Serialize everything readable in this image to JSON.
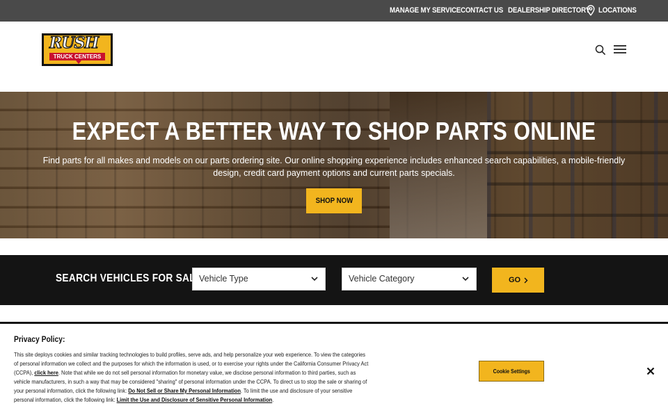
{
  "utility_nav": {
    "manage_service": "MANAGE MY SERVICE",
    "contact_us": "CONTACT US",
    "dealership_directory": "DEALERSHIP DIRECTORY",
    "locations": "LOCATIONS"
  },
  "header": {
    "logo_text": "RUSH",
    "logo_subtext": "TRUCK CENTERS",
    "search_icon": "search-icon",
    "menu_icon": "hamburger-menu-icon"
  },
  "hero": {
    "title": "EXPECT A BETTER WAY TO SHOP PARTS ONLINE",
    "description": "Find parts for all makes and models on our parts ordering site. Our online shopping experience includes enhanced search capabilities, a mobile-friendly design, credit card payment options and current parts specials.",
    "cta_label": "SHOP NOW"
  },
  "vehicle_search": {
    "label": "SEARCH VEHICLES FOR SALE:",
    "vehicle_type": "Vehicle Type",
    "vehicle_category": "Vehicle Category",
    "go_label": "GO"
  },
  "cookie_banner": {
    "title": "Privacy Policy:",
    "text_1": "This site deploys cookies and similar tracking technologies to build profiles, serve ads, and help personalize your web experience. To view the categories of personal information we collect and the purposes for which the information is used, or to exercise your rights under the California Consumer Privacy Act (CCPA), ",
    "link_click_here": "click here",
    "text_2": ". Note that while we do not sell personal information for monetary value, we disclose personal information to third parties, such as vehicle manufacturers, in such a way that may be considered \"sharing\" of personal information under the CCPA. To direct us to stop the sale or sharing of your personal information, click the following link: ",
    "link_do_not_sell": "Do Not Sell or Share My Personal Information",
    "text_3": ". To limit the use and disclosure of your sensitive personal information, click the following link: ",
    "link_limit_use": "Limit the Use and Disclosure of Sensitive Personal Information",
    "text_4": ".",
    "settings_label": "Cookie Settings"
  },
  "colors": {
    "accent_yellow": "#f2b51e",
    "brand_red": "#c8102e",
    "utility_gray": "#4a4a4a",
    "dark_bar": "#141414"
  }
}
